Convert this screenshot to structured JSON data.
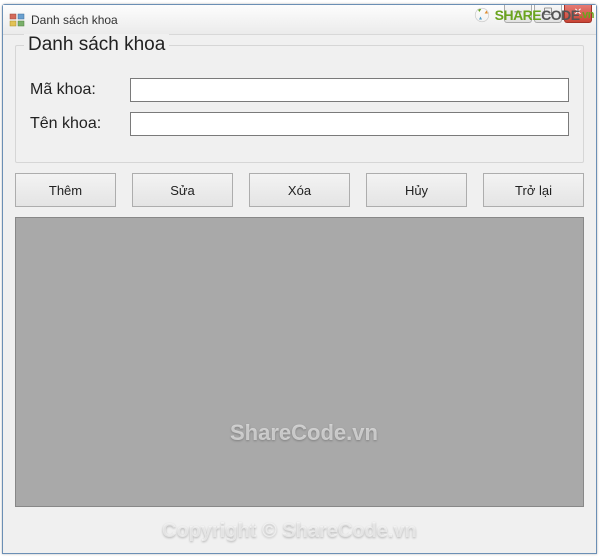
{
  "window": {
    "title": "Danh sách khoa"
  },
  "groupbox": {
    "legend": "Danh sách khoa",
    "fields": {
      "ma_khoa_label": "Mã khoa:",
      "ma_khoa_value": "",
      "ten_khoa_label": "Tên khoa:",
      "ten_khoa_value": ""
    }
  },
  "buttons": {
    "them": "Thêm",
    "sua": "Sửa",
    "xoa": "Xóa",
    "huy": "Hủy",
    "tro_lai": "Trở lại"
  },
  "watermark": {
    "logo_share": "SHARE",
    "logo_code": "CODE",
    "logo_vn": ".vn",
    "center1": "ShareCode.vn",
    "center2": "Copyright © ShareCode.vn"
  }
}
